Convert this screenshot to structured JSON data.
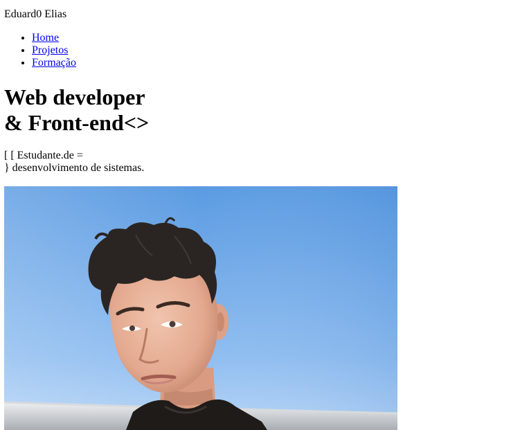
{
  "header": {
    "brand": "Eduard0 Elias"
  },
  "nav": {
    "items": [
      {
        "label": "Home"
      },
      {
        "label": "Projetos"
      },
      {
        "label": "Formação"
      }
    ]
  },
  "hero": {
    "headline_line1": "Web developer",
    "headline_line2": "& Front-end<>",
    "tagline_line1": "[ [ Estudante.de =",
    "tagline_line2": "} desenvolvimento de sistemas."
  },
  "photo": {
    "subject": "portrait-photo",
    "colors": {
      "sky_top": "#5e9fe4",
      "sky_bottom": "#a9cdf5",
      "hair": "#2a2522",
      "skin": "#e8b39a",
      "jacket": "#1f1b19"
    }
  }
}
